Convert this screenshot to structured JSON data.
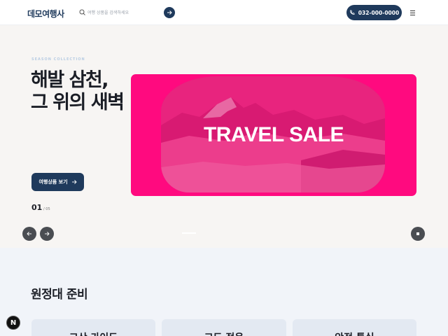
{
  "header": {
    "logo": "데모여행사",
    "search_placeholder": "여행 상품을 검색하세요",
    "phone": "032-000-0000"
  },
  "hero": {
    "eyebrow": "SEASON COLLECTION",
    "title": "해발 삼천, 그 위의 새벽",
    "description": "",
    "cta_label": "여행상품 보기",
    "slide_current": "01",
    "slide_total": "/ 05",
    "banner_text": "TRAVEL SALE"
  },
  "section": {
    "title": "원정대 준비",
    "cards": [
      {
        "title": "고산 가이드"
      },
      {
        "title": "고도 적응"
      },
      {
        "title": "안전 특실"
      }
    ]
  },
  "badge": "N",
  "colors": {
    "primary": "#1f3a5c",
    "banner": "#ff0a7f",
    "hero_bg": "#f7f5f3",
    "section_bg": "#f1f4f9"
  }
}
